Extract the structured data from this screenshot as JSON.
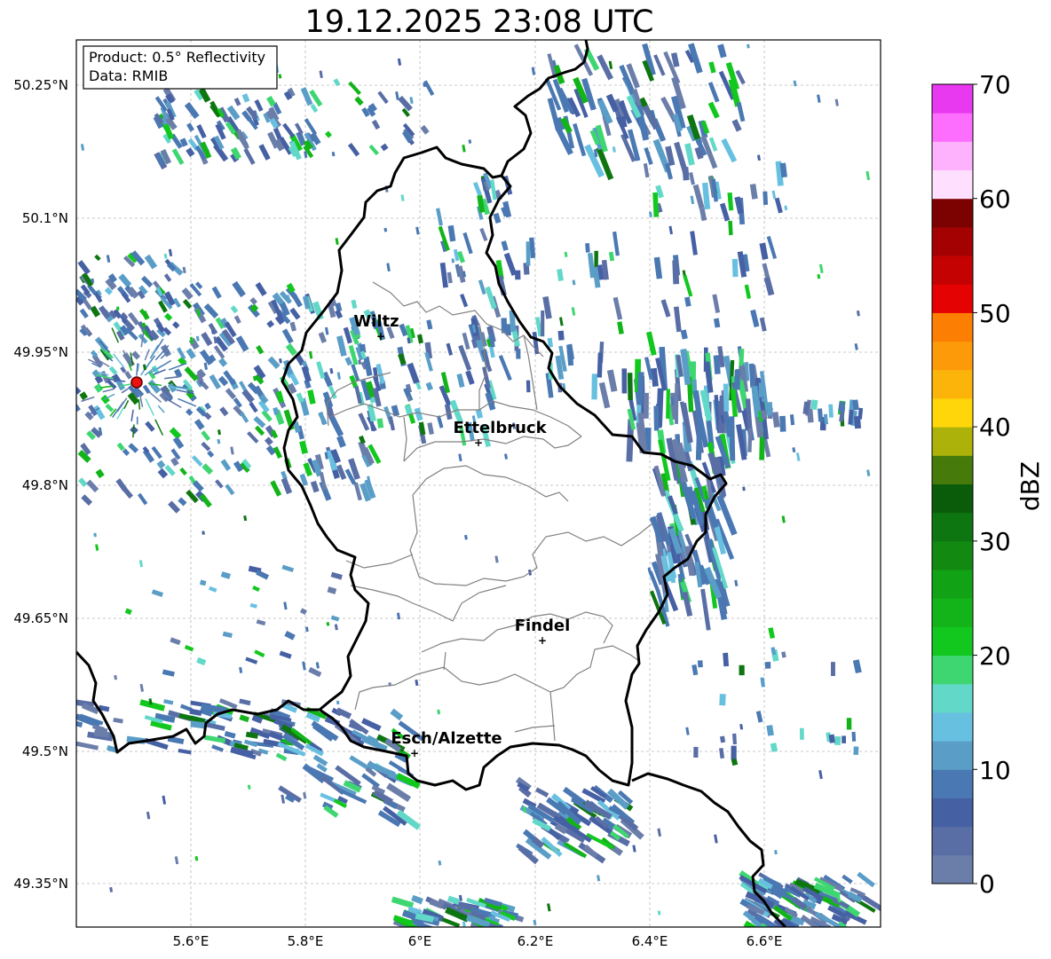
{
  "title": "19.12.2025 23:08 UTC",
  "info_box": {
    "product": "Product: 0.5° Reflectivity",
    "data": "Data: RMIB"
  },
  "lat_ticks": [
    "50.25°N",
    "50.1°N",
    "49.95°N",
    "49.8°N",
    "49.65°N",
    "49.5°N",
    "49.35°N"
  ],
  "lon_ticks": [
    "5.6°E",
    "5.8°E",
    "6°E",
    "6.2°E",
    "6.4°E",
    "6.6°E"
  ],
  "cities": [
    {
      "name": "Wiltz"
    },
    {
      "name": "Ettelbruck"
    },
    {
      "name": "Findel"
    },
    {
      "name": "Esch/Alzette"
    }
  ],
  "colorbar": {
    "label": "dBZ",
    "ticks": [
      "0",
      "10",
      "20",
      "30",
      "40",
      "50",
      "60",
      "70"
    ],
    "colors": [
      "#6b7eaa",
      "#5a6ea6",
      "#4660a4",
      "#4a78b2",
      "#5a9ec8",
      "#68c0e0",
      "#62d8c8",
      "#3ed670",
      "#12c81e",
      "#12b41a",
      "#12a216",
      "#128a12",
      "#0e7610",
      "#0a5c0a",
      "#467a0a",
      "#acb20a",
      "#fed60a",
      "#fcb40a",
      "#fc9a0a",
      "#fc7e02",
      "#e40202",
      "#c40202",
      "#a40202",
      "#7c0202",
      "#fee0fe",
      "#feb2fe",
      "#fe6efe",
      "#e838f0"
    ]
  },
  "radar_site_color": "#ee1111"
}
